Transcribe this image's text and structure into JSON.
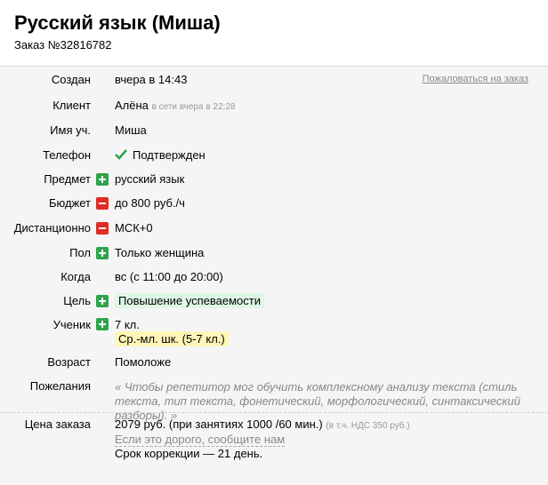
{
  "header": {
    "title": "Русский язык (Миша)",
    "order_number": "Заказ №32816782"
  },
  "complain_link": "Пожаловаться на заказ",
  "rows": {
    "created": {
      "label": "Создан",
      "value": "вчера в 14:43"
    },
    "client": {
      "label": "Клиент",
      "value": "Алёна",
      "status": "в сети вчера в 22:28"
    },
    "student_name": {
      "label": "Имя уч.",
      "value": "Миша"
    },
    "phone": {
      "label": "Телефон",
      "value": "Подтвержден",
      "icon": "checkmark-icon"
    },
    "subject": {
      "label": "Предмет",
      "value": "русский язык",
      "icon": "plus-icon"
    },
    "budget": {
      "label": "Бюджет",
      "value": "до 800 руб./ч",
      "icon": "minus-icon"
    },
    "remote": {
      "label": "Дистанционно",
      "value": "МСК+0",
      "icon": "minus-icon"
    },
    "gender": {
      "label": "Пол",
      "value": "Только женщина",
      "icon": "plus-icon"
    },
    "when": {
      "label": "Когда",
      "value": "вс (с 11:00 до 20:00)"
    },
    "goal": {
      "label": "Цель",
      "value": "Повышение успеваемости",
      "icon": "plus-icon"
    },
    "pupil": {
      "label": "Ученик",
      "value": "7 кл.",
      "tag": "Ср.-мл. шк. (5-7 кл.)",
      "icon": "plus-icon"
    },
    "age": {
      "label": "Возраст",
      "value": "Помоложе"
    },
    "wishes": {
      "label": "Пожелания",
      "value": "« Чтобы репетитор мог обучить комплексному анализу текста (стиль текста, тип текста, фонетический, морфологический, синтаксический разборы). »"
    }
  },
  "price": {
    "label": "Цена заказа",
    "value": "2079 руб. (при занятиях 1000 /60 мин.)",
    "vat": "(в т.ч. НДС 350 руб.)",
    "expensive_link": "Если это дорого, сообщите нам",
    "correction": "Срок коррекции — 21 день."
  },
  "colors": {
    "plus": "#2ea34b",
    "minus": "#e02b27",
    "goal_highlight": "#dff7e6",
    "class_highlight": "#fff6b8"
  }
}
